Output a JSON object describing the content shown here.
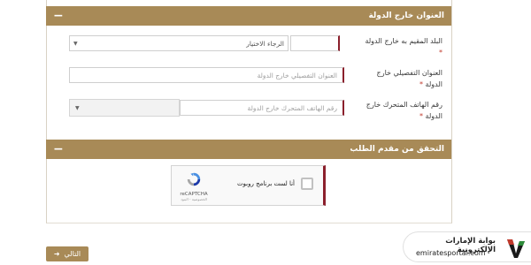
{
  "section_outside": {
    "title": "العنوان خارج الدولة",
    "collapse_symbol": "−"
  },
  "fields": {
    "country": {
      "label": "البلد المقيم به خارج الدولة",
      "required_mark": "*",
      "select_value": "الرجاء الاختيار"
    },
    "address": {
      "label": "العنوان التفصيلي خارج الدولة",
      "required_mark": "*",
      "placeholder": "العنوان التفصيلي خارج الدولة"
    },
    "phone": {
      "label": "رقم الهاتف المتحرك خارج الدولة",
      "required_mark": "*",
      "placeholder": "رقم الهاتف المتحرك خارج الدولة"
    }
  },
  "section_verify": {
    "title": "التحقق من مقدم الطلب",
    "collapse_symbol": "−"
  },
  "recaptcha": {
    "checkbox_label": "أنا لست برنامج روبوت",
    "brand": "reCAPTCHA",
    "privacy": "الخصوصية - البنود"
  },
  "next_button": {
    "label": "التالي",
    "icon": "arrow-left-icon"
  },
  "watermark": {
    "arabic": "بوابة الإمارات الإلكترونية",
    "english": "emiratesportal.com"
  },
  "colors": {
    "header_bg": "#a88a57",
    "required_accent": "#8b1f2c"
  }
}
